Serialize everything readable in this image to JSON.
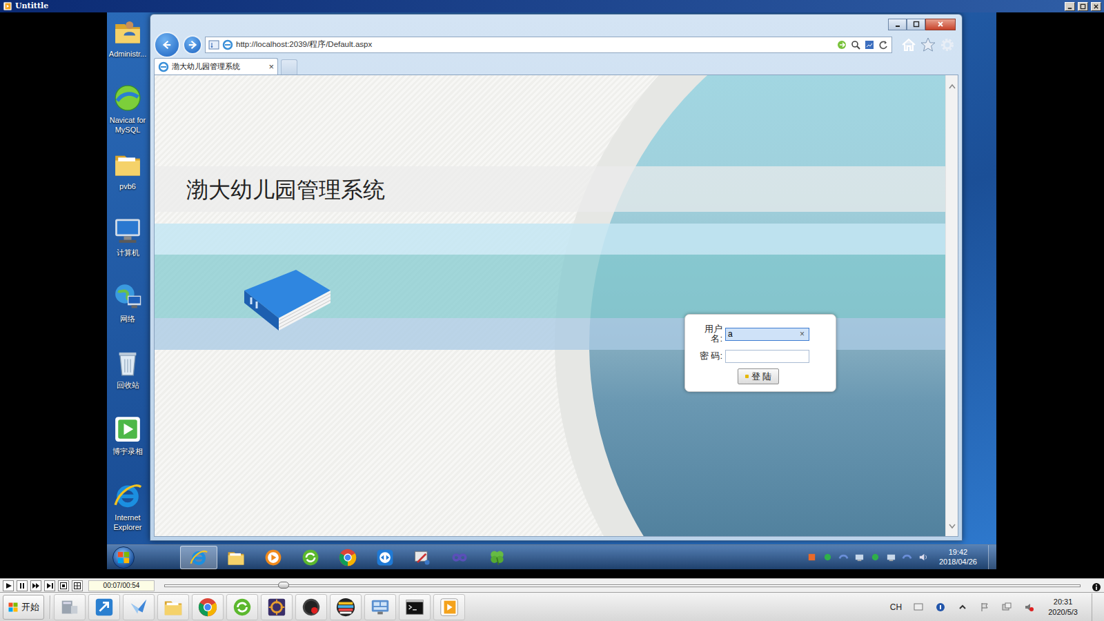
{
  "player": {
    "title": "Untittle",
    "time": "00:07/00:54",
    "level": 0.13
  },
  "desktop": {
    "icons": [
      {
        "label": "Administr..."
      },
      {
        "label": "Navicat for MySQL"
      },
      {
        "label": "pvb6"
      },
      {
        "label": "计算机"
      },
      {
        "label": "网络"
      },
      {
        "label": "回收站"
      },
      {
        "label": "博宇录相"
      },
      {
        "label": "Internet Explorer"
      }
    ]
  },
  "browser": {
    "address": "http://localhost:2039/程序/Default.aspx",
    "tabs": [
      {
        "label": "渤大幼儿园管理系统",
        "close": "×",
        "selected": true
      }
    ]
  },
  "page": {
    "title": "渤大幼儿园管理系统",
    "login": {
      "username": {
        "label": "用户名:",
        "value": "a",
        "clear": "×",
        "focused": true
      },
      "password": {
        "label": "密 码:",
        "value": "",
        "focused": false
      },
      "button": "登 陆"
    }
  },
  "taskbar": {
    "apps": [
      {
        "selected": true
      },
      {
        "selected": false
      },
      {
        "selected": false
      },
      {
        "selected": false
      },
      {
        "selected": false
      },
      {
        "selected": false
      },
      {
        "selected": false
      },
      {
        "selected": false
      },
      {
        "selected": false
      }
    ],
    "time": "19:42",
    "date": "2018/04/26"
  },
  "host_taskbar": {
    "start": "开始",
    "lang": "CH",
    "time": "20:31",
    "date": "2020/5/3"
  }
}
